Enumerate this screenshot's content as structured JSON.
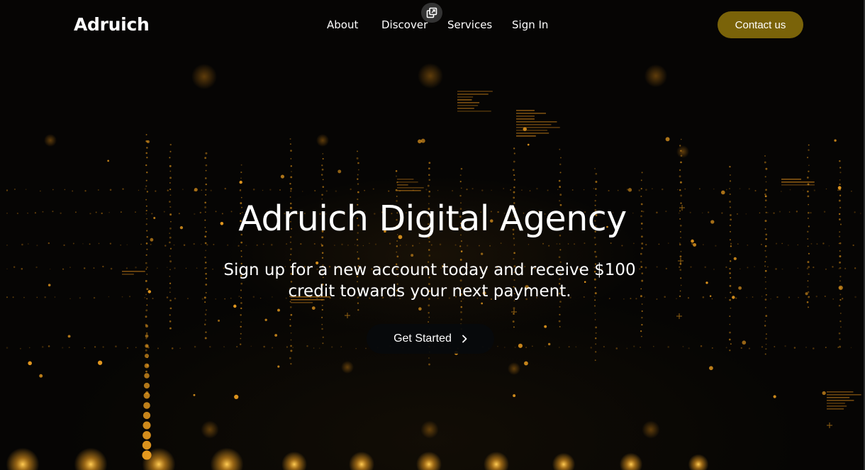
{
  "brand": {
    "logo_text": "Adruich"
  },
  "nav": {
    "items": [
      {
        "label": "About"
      },
      {
        "label": "Discover"
      },
      {
        "label": "Services"
      },
      {
        "label": "Sign In"
      }
    ]
  },
  "header": {
    "contact_label": "Contact us"
  },
  "hero": {
    "title": "Adruich Digital Agency",
    "subtitle": "Sign up for a new account today and receive $100 credit towards your next payment.",
    "cta_label": "Get Started"
  },
  "colors": {
    "background": "#060504",
    "accent": "#7a6309",
    "particle": "#f0a020",
    "text": "#ffffff"
  },
  "icons": {
    "floating": "copy-icon",
    "cta": "chevron-right-icon"
  }
}
